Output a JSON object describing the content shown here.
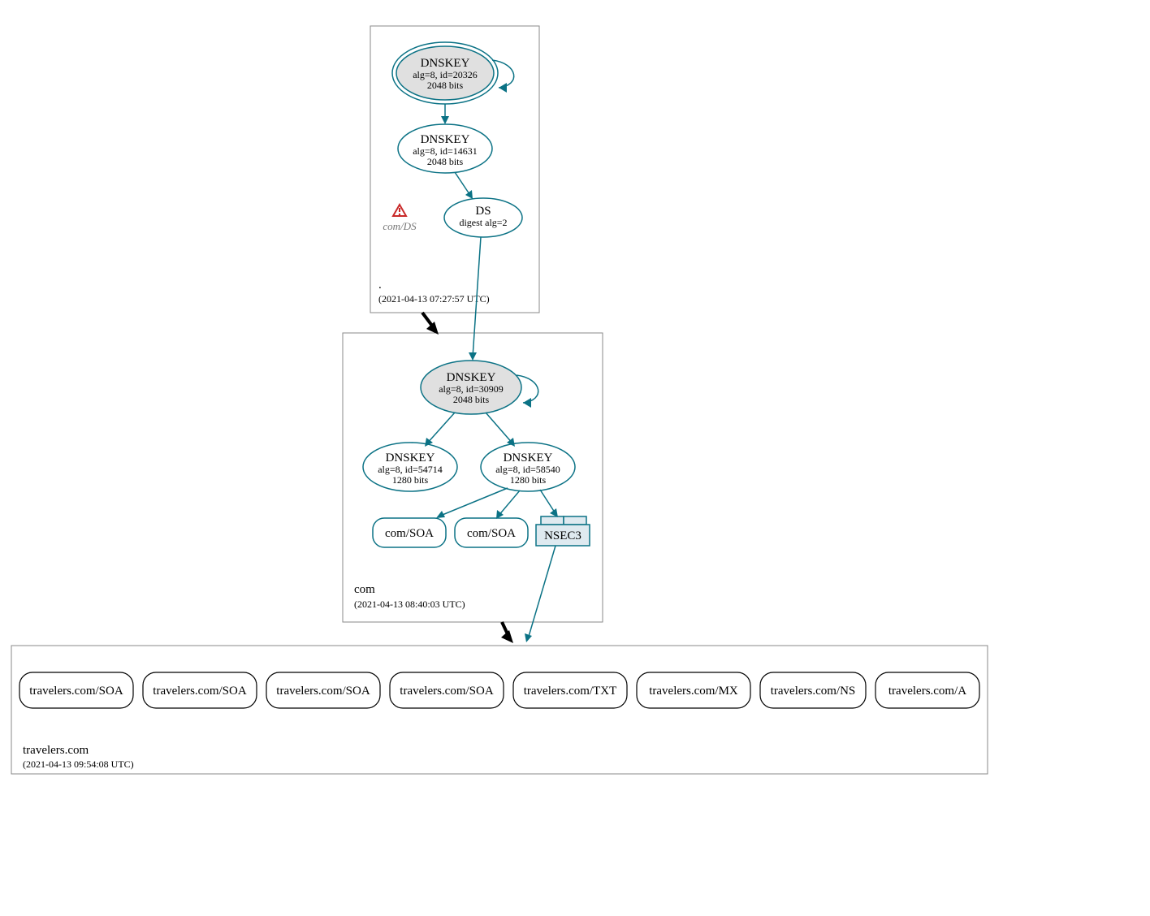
{
  "zones": {
    "root": {
      "label": ".",
      "timestamp": "(2021-04-13 07:27:57 UTC)"
    },
    "com": {
      "label": "com",
      "timestamp": "(2021-04-13 08:40:03 UTC)"
    },
    "travelers": {
      "label": "travelers.com",
      "timestamp": "(2021-04-13 09:54:08 UTC)"
    }
  },
  "nodes": {
    "root_ksk": {
      "title": "DNSKEY",
      "line2": "alg=8, id=20326",
      "line3": "2048 bits"
    },
    "root_zsk": {
      "title": "DNSKEY",
      "line2": "alg=8, id=14631",
      "line3": "2048 bits"
    },
    "root_ds": {
      "title": "DS",
      "line2": "digest alg=2"
    },
    "root_warn_label": "com/DS",
    "com_ksk": {
      "title": "DNSKEY",
      "line2": "alg=8, id=30909",
      "line3": "2048 bits"
    },
    "com_zsk_a": {
      "title": "DNSKEY",
      "line2": "alg=8, id=54714",
      "line3": "1280 bits"
    },
    "com_zsk_b": {
      "title": "DNSKEY",
      "line2": "alg=8, id=58540",
      "line3": "1280 bits"
    },
    "com_soa_a": "com/SOA",
    "com_soa_b": "com/SOA",
    "com_nsec3": "NSEC3",
    "trav": [
      "travelers.com/SOA",
      "travelers.com/SOA",
      "travelers.com/SOA",
      "travelers.com/SOA",
      "travelers.com/TXT",
      "travelers.com/MX",
      "travelers.com/NS",
      "travelers.com/A"
    ]
  }
}
